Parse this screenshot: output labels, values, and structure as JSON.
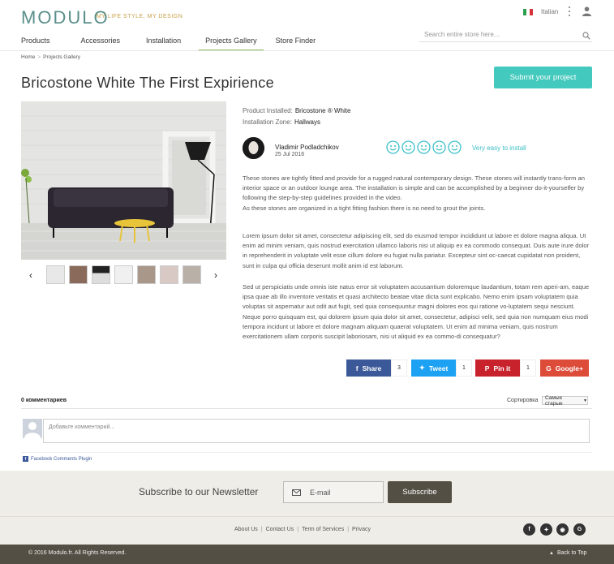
{
  "header": {
    "logo_text": "MODULO",
    "tagline": "MY LIFE STYLE, MY DESIGN",
    "language": "Italian",
    "search_placeholder": "Search entire store here..."
  },
  "nav": {
    "items": [
      "Products",
      "Accessories",
      "Installation",
      "Projects Gallery",
      "Store Finder"
    ],
    "active": "Projects Gallery"
  },
  "breadcrumb": {
    "home": "Home",
    "current": "Projects Gallery"
  },
  "page": {
    "title": "Bricostone White The First Expirience",
    "submit_label": "Submit your project"
  },
  "product": {
    "installed_label": "Product Installed:",
    "installed_value": "Bricostone ® White",
    "zone_label": "Installation Zone:",
    "zone_value": "Hallways"
  },
  "author": {
    "name": "Vladimir Podladchikov",
    "date": "25 Jul 2016"
  },
  "rating": {
    "smileys": 5,
    "text": "Very easy to install"
  },
  "description": {
    "p1": "These stones are tightly fitted and provide for a rugged natural contemporary design. These stones will instantly trans-form an interior space or an outdoor lounge area. The installation is simple and can be accomplished by a beginner do-it-yourselfer by following the step-by-step guidelines provided in the video.",
    "p1b": "As these stones are organized in a tight fitting fashion there is no need to grout the joints.",
    "p2": "Lorem ipsum dolor sit amet, consectetur adipiscing elit, sed do eiusmod tempor incididunt ut labore et dolore magna aliqua. Ut enim ad minim veniam, quis nostrud exercitation ullamco laboris nisi ut aliquip ex ea commodo consequat. Duis aute irure dolor in reprehenderit in voluptate velit esse cillum dolore eu fugiat nulla pariatur. Excepteur sint oc-caecat cupidatat non proident, sunt in culpa qui officia deserunt mollit anim id est laborum.",
    "p3": "Sed ut perspiciatis unde omnis iste natus error sit voluptatem accusantium doloremque laudantium, totam rem aperi-am, eaque ipsa quae ab illo inventore veritatis et quasi architecto beatae vitae dicta sunt explicabo. Nemo enim ipsam voluptatem quia voluptas sit aspernatur aut odit aut fugit, sed quia consequuntur magni dolores eos qui ratione vo-luptatem sequi nesciunt. Neque porro quisquam est, qui dolorem ipsum quia dolor sit amet, consectetur, adipisci velit, sed quia non numquam eius modi tempora incidunt ut labore et dolore magnam aliquam quaerat voluptatem. Ut enim ad minima veniam, quis nostrum exercitationem ullam corporis suscipit laboriosam, nisi ut aliquid ex ea commo-di consequatur?"
  },
  "share": {
    "facebook": {
      "label": "Share",
      "count": "3",
      "color": "#3b5998"
    },
    "twitter": {
      "label": "Tweet",
      "count": "1",
      "color": "#1da1f2"
    },
    "pinterest": {
      "label": "Pin it",
      "count": "1",
      "color": "#c8232c"
    },
    "google": {
      "label": "Google+",
      "color": "#dd4b39"
    }
  },
  "comments": {
    "count_label": "0 комментариев",
    "sort_label": "Сортировка",
    "sort_value": "Самые старые",
    "input_placeholder": "Добавьте комментарий...",
    "plugin_label": "Facebook Comments Plugin"
  },
  "newsletter": {
    "title": "Subscribe to our Newsletter",
    "email_placeholder": "E-mail",
    "button": "Subscribe"
  },
  "footer": {
    "links": [
      "About Us",
      "Contact Us",
      "Term of Services",
      "Privacy"
    ],
    "copyright": "© 2016 Modulo.fr. All Rights Reserved.",
    "back_to_top": "Back to Top"
  },
  "colors": {
    "accent": "#43c9bd",
    "nav_active": "#8cbf6b",
    "footer_dark": "#544f44",
    "footer_light": "#efede7"
  }
}
